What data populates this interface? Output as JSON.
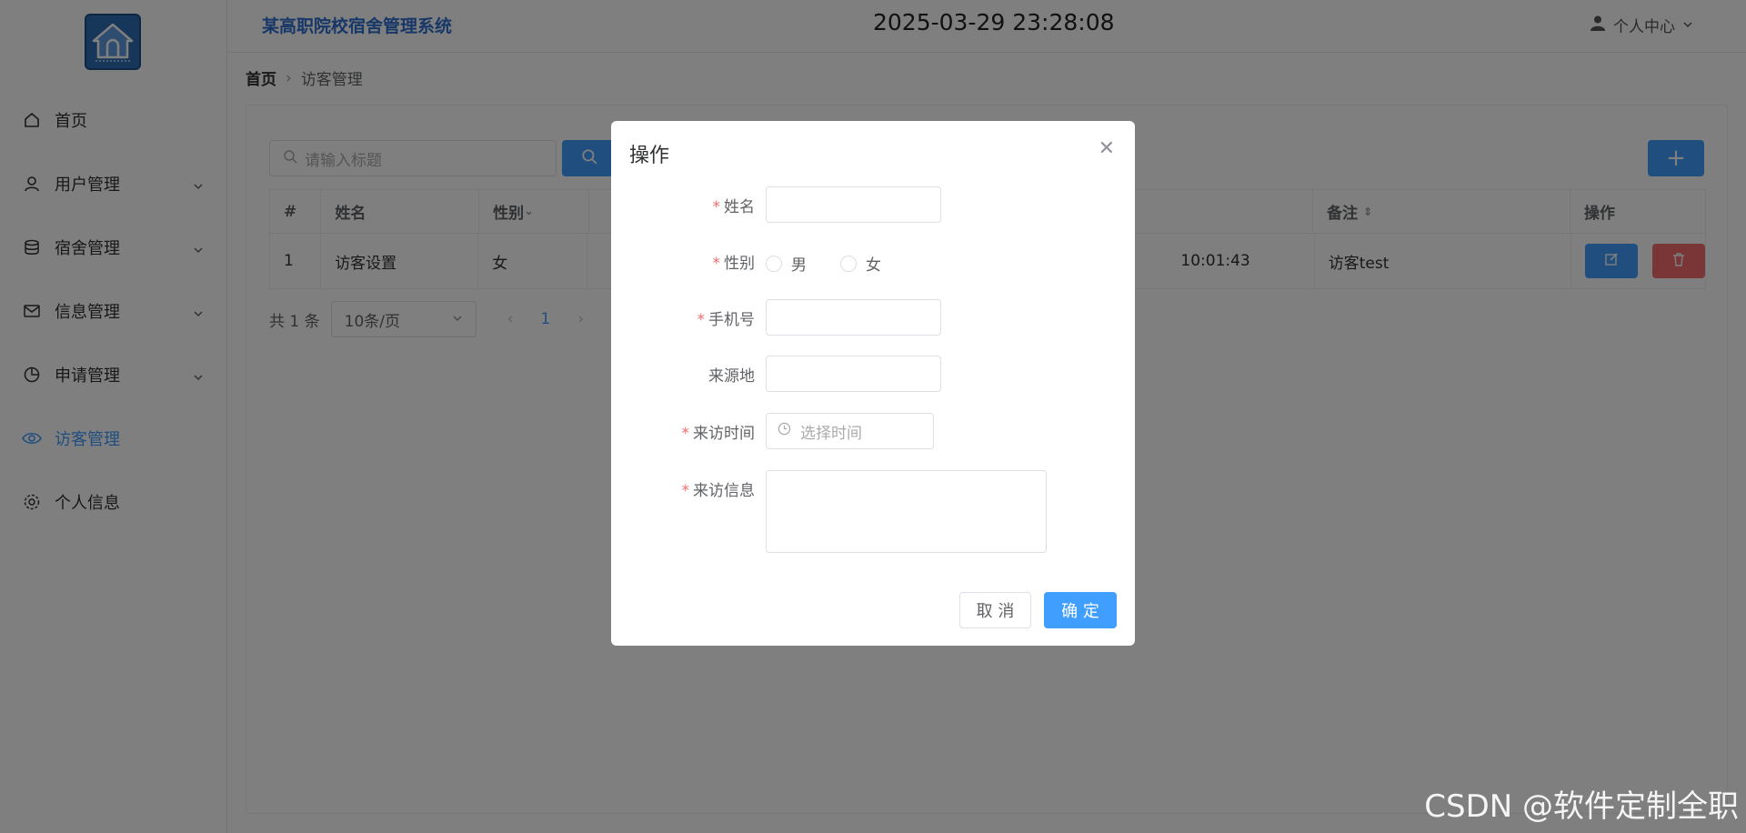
{
  "app": {
    "title": "某高职院校宿舍管理系统",
    "clock": "2025-03-29 23:28:08",
    "user_menu": "个人中心"
  },
  "sidebar": {
    "items": [
      {
        "label": "首页",
        "icon": "home-icon"
      },
      {
        "label": "用户管理",
        "icon": "user-icon"
      },
      {
        "label": "宿舍管理",
        "icon": "database-icon"
      },
      {
        "label": "信息管理",
        "icon": "mail-icon"
      },
      {
        "label": "申请管理",
        "icon": "pie-chart-icon"
      },
      {
        "label": "访客管理",
        "icon": "eye-icon",
        "active": true
      },
      {
        "label": "个人信息",
        "icon": "gear-icon"
      }
    ]
  },
  "breadcrumb": {
    "home": "首页",
    "current": "访客管理"
  },
  "search": {
    "placeholder": "请输入标题"
  },
  "table": {
    "headers": [
      "#",
      "姓名",
      "性别",
      "备注",
      "操作"
    ],
    "rows": [
      {
        "index": "1",
        "name": "访客设置",
        "gender": "女",
        "time": "10:01:43",
        "remark": "访客test"
      }
    ]
  },
  "pagination": {
    "total": "共 1 条",
    "page_size": "10条/页",
    "current_page": "1"
  },
  "dialog": {
    "title": "操作",
    "fields": {
      "name": "姓名",
      "gender": "性别",
      "phone": "手机号",
      "origin": "来源地",
      "visit_time": "来访时间",
      "visit_info": "来访信息"
    },
    "gender_options": [
      "男",
      "女"
    ],
    "date_placeholder": "选择时间",
    "cancel_label": "取 消",
    "ok_label": "确 定",
    "required_mark": "*"
  },
  "watermark": "CSDN @软件定制全职",
  "colors": {
    "primary": "#409eff",
    "danger": "#f56c6c",
    "title": "#2f6fd1"
  }
}
